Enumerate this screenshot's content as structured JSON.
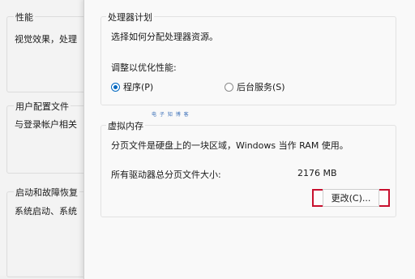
{
  "background_dialog": {
    "performance_title": "性能",
    "performance_text": "视觉效果，处理",
    "user_profiles_title": "用户配置文件",
    "user_profiles_text": "与登录帐户相关",
    "startup_recovery_title": "启动和故障恢复",
    "startup_recovery_text": "系统启动、系统"
  },
  "processor_scheduling": {
    "title": "处理器计划",
    "description": "选择如何分配处理器资源。",
    "adjust_label": "调整以优化性能:",
    "options": [
      {
        "label": "程序(P)",
        "selected": true
      },
      {
        "label": "后台服务(S)",
        "selected": false
      }
    ]
  },
  "watermark": "电 子 知 博 客",
  "virtual_memory": {
    "title": "虚拟内存",
    "description": "分页文件是硬盘上的一块区域，Windows 当作 RAM 使用。",
    "total_label": "所有驱动器总分页文件大小:",
    "total_value": "2176 MB",
    "change_button": "更改(C)..."
  },
  "colors": {
    "accent": "#0067c0",
    "highlight_box": "#c8102e"
  }
}
